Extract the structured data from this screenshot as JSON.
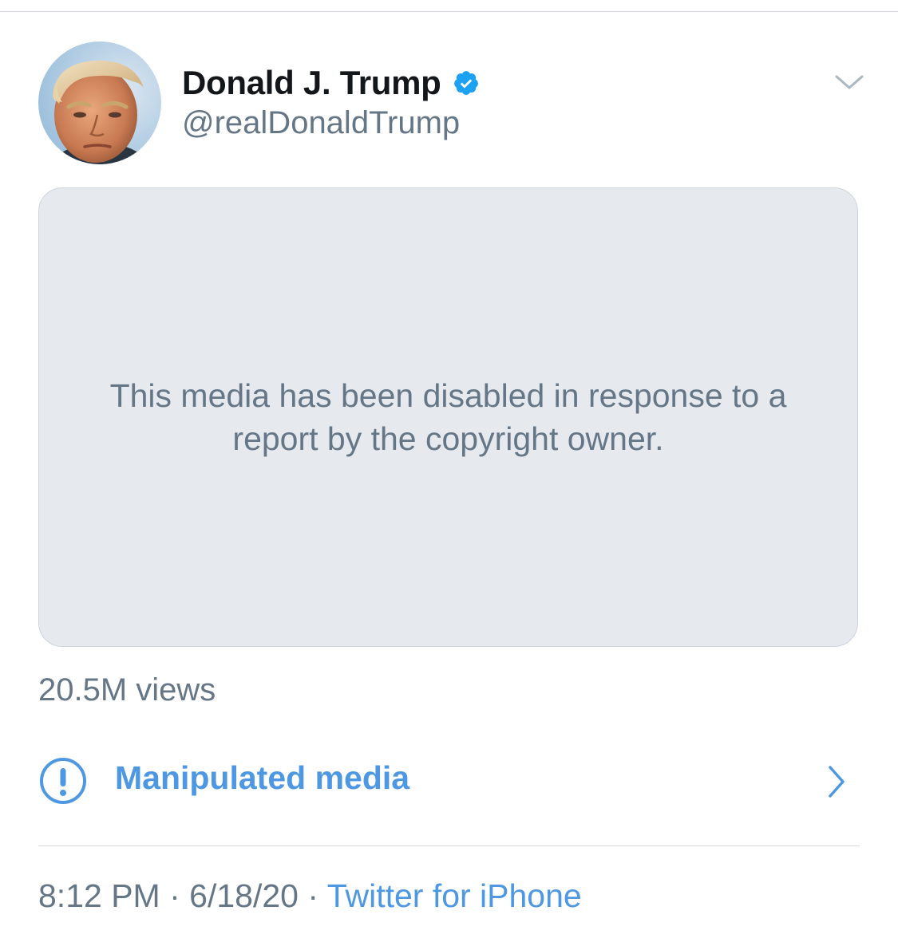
{
  "author": {
    "display_name": "Donald J. Trump",
    "handle": "@realDonaldTrump",
    "verified": true,
    "avatar_icon": "profile-photo"
  },
  "media": {
    "message": "This media has been disabled in response to a report by the copyright owner."
  },
  "stats": {
    "views": "20.5M views"
  },
  "label": {
    "text": "Manipulated media",
    "icon": "exclamation-circle-icon"
  },
  "meta": {
    "time": "8:12 PM",
    "separator": "·",
    "date": "6/18/20",
    "source": "Twitter for iPhone"
  },
  "colors": {
    "accent": "#4e98e3",
    "secondary_text": "#657786",
    "primary_text": "#14171a",
    "media_bg": "#e6e9ee",
    "verified": "#1da1f2"
  }
}
